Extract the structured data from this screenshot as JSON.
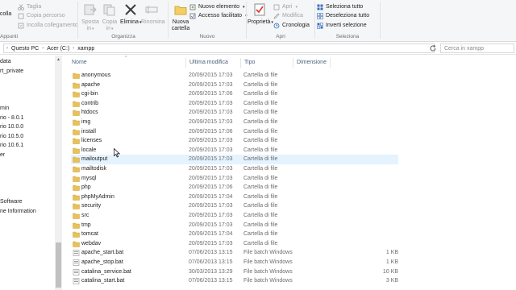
{
  "ribbon": {
    "clipboard": {
      "cut": "Taglia",
      "copy_path": "Copia percorso",
      "paste_shortcut": "Incolla collegamento",
      "paste": "Incolla",
      "label": "Appunti"
    },
    "organize": {
      "move_to": "Sposta in",
      "copy_to": "Copia in",
      "delete": "Elimina",
      "rename": "Rinomina",
      "label": "Organizza"
    },
    "new": {
      "new_folder": "Nuova cartella",
      "new_item": "Nuovo elemento",
      "easy_access": "Accesso facilitato",
      "label": "Nuovo"
    },
    "open": {
      "properties": "Proprietà",
      "open": "Apri",
      "edit": "Modifica",
      "history": "Cronologia",
      "label": "Apri"
    },
    "select": {
      "select_all": "Seleziona tutto",
      "select_none": "Deseleziona tutto",
      "invert": "Inverti selezione",
      "label": "Seleziona"
    }
  },
  "address": {
    "crumbs": [
      "Questo PC",
      "Acer (C:)",
      "xampp"
    ],
    "search_placeholder": "Cerca in xampp"
  },
  "nav": {
    "items": [
      "data",
      "rt_private",
      "",
      "",
      "",
      "min",
      "rio - 8.0.1",
      "rio 10.0.0",
      "rio 10.5.0",
      "rio 10.6.1",
      "er",
      "",
      "",
      "",
      "",
      "Software",
      "ne Information"
    ]
  },
  "columns": {
    "name": "Nome",
    "modified": "Ultima modifica",
    "type": "Tipo",
    "size": "Dimensione"
  },
  "files": [
    {
      "name": "anonymous",
      "date": "20/09/2015 17:03",
      "type": "Cartella di file",
      "size": "",
      "kind": "folder"
    },
    {
      "name": "apache",
      "date": "20/09/2015 17:03",
      "type": "Cartella di file",
      "size": "",
      "kind": "folder"
    },
    {
      "name": "cgi-bin",
      "date": "20/09/2015 17:06",
      "type": "Cartella di file",
      "size": "",
      "kind": "folder"
    },
    {
      "name": "contrib",
      "date": "20/09/2015 17:03",
      "type": "Cartella di file",
      "size": "",
      "kind": "folder"
    },
    {
      "name": "htdocs",
      "date": "20/09/2015 17:03",
      "type": "Cartella di file",
      "size": "",
      "kind": "folder"
    },
    {
      "name": "img",
      "date": "20/09/2015 17:03",
      "type": "Cartella di file",
      "size": "",
      "kind": "folder"
    },
    {
      "name": "install",
      "date": "20/09/2015 17:06",
      "type": "Cartella di file",
      "size": "",
      "kind": "folder"
    },
    {
      "name": "licenses",
      "date": "20/09/2015 17:03",
      "type": "Cartella di file",
      "size": "",
      "kind": "folder"
    },
    {
      "name": "locale",
      "date": "20/09/2015 17:03",
      "type": "Cartella di file",
      "size": "",
      "kind": "folder"
    },
    {
      "name": "mailoutput",
      "date": "20/09/2015 17:03",
      "type": "Cartella di file",
      "size": "",
      "kind": "folder",
      "hover": true
    },
    {
      "name": "mailtodisk",
      "date": "20/09/2015 17:03",
      "type": "Cartella di file",
      "size": "",
      "kind": "folder"
    },
    {
      "name": "mysql",
      "date": "20/09/2015 17:03",
      "type": "Cartella di file",
      "size": "",
      "kind": "folder"
    },
    {
      "name": "php",
      "date": "20/09/2015 17:06",
      "type": "Cartella di file",
      "size": "",
      "kind": "folder"
    },
    {
      "name": "phpMyAdmin",
      "date": "20/09/2015 17:04",
      "type": "Cartella di file",
      "size": "",
      "kind": "folder"
    },
    {
      "name": "security",
      "date": "20/09/2015 17:03",
      "type": "Cartella di file",
      "size": "",
      "kind": "folder"
    },
    {
      "name": "src",
      "date": "20/09/2015 17:03",
      "type": "Cartella di file",
      "size": "",
      "kind": "folder"
    },
    {
      "name": "tmp",
      "date": "20/09/2015 17:03",
      "type": "Cartella di file",
      "size": "",
      "kind": "folder"
    },
    {
      "name": "tomcat",
      "date": "20/09/2015 17:04",
      "type": "Cartella di file",
      "size": "",
      "kind": "folder"
    },
    {
      "name": "webdav",
      "date": "20/09/2015 17:03",
      "type": "Cartella di file",
      "size": "",
      "kind": "folder"
    },
    {
      "name": "apache_start.bat",
      "date": "07/06/2013 13:15",
      "type": "File batch Windows",
      "size": "1 KB",
      "kind": "bat"
    },
    {
      "name": "apache_stop.bat",
      "date": "07/06/2013 13:15",
      "type": "File batch Windows",
      "size": "1 KB",
      "kind": "bat"
    },
    {
      "name": "catalina_service.bat",
      "date": "30/03/2013 13:29",
      "type": "File batch Windows",
      "size": "10 KB",
      "kind": "bat"
    },
    {
      "name": "catalina_start.bat",
      "date": "07/06/2013 13:15",
      "type": "File batch Windows",
      "size": "3 KB",
      "kind": "bat"
    }
  ],
  "colors": {
    "folder": "#e8c15a",
    "hover_row": "#e5f3ff",
    "header_text": "#4c607a"
  }
}
